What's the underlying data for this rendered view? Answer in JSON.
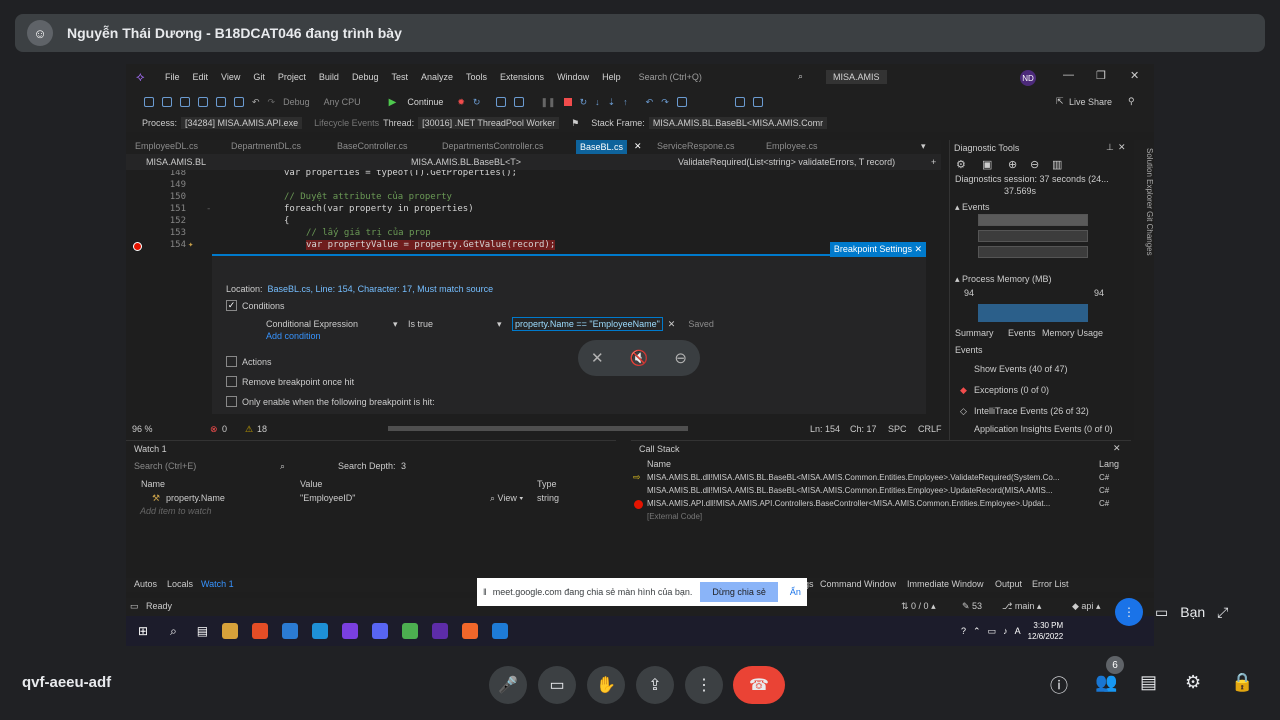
{
  "meet": {
    "presenter_banner": "Nguyễn Thái Dương - B18DCAT046 đang trình bày",
    "avatar_glyph": "☺",
    "meeting_code": "qvf-aeeu-adf",
    "you_label": "Bạn",
    "participant_count": "6",
    "share_notice": "meet.google.com đang chia sẻ màn hình của bạn.",
    "stop_share_label": "Dừng chia sẻ",
    "hide_label": "Ẩn"
  },
  "vs": {
    "menu": [
      "File",
      "Edit",
      "View",
      "Git",
      "Project",
      "Build",
      "Debug",
      "Test",
      "Analyze",
      "Tools",
      "Extensions",
      "Window",
      "Help"
    ],
    "search_placeholder": "Search (Ctrl+Q)",
    "solution_name": "MISA.AMIS",
    "user_initials": "ND",
    "toolbar": {
      "config": "Debug",
      "platform": "Any CPU",
      "continue_label": "Continue",
      "live_share": "Live Share"
    },
    "debug_bar": {
      "process_label": "Process:",
      "process_value": "[34284] MISA.AMIS.API.exe",
      "lifecycle_label": "Lifecycle Events",
      "thread_label": "Thread:",
      "thread_value": "[30016] .NET ThreadPool Worker",
      "stack_label": "Stack Frame:",
      "stack_value": "MISA.AMIS.BL.BaseBL<MISA.AMIS.Comr"
    },
    "tabs": [
      "EmployeeDL.cs",
      "DepartmentDL.cs",
      "BaseController.cs",
      "DepartmentsController.cs",
      "BaseBL.cs",
      "ServiceRespone.cs",
      "Employee.cs"
    ],
    "nav": {
      "project": "MISA.AMIS.BL",
      "class": "MISA.AMIS.BL.BaseBL<T>",
      "method": "ValidateRequired(List<string> validateErrors, T record)"
    },
    "code": {
      "line_148": "148",
      "line_149": "149",
      "line_150": "150",
      "line_151": "151",
      "line_152": "152",
      "line_153": "153",
      "line_154": "154",
      "text_148": "var properties = typeof(T).GetProperties();",
      "text_150": "// Duyệt attribute của property",
      "text_151": "foreach(var property in properties)",
      "text_152": "{",
      "text_153": "// lấy giá trị của prop",
      "text_154": "var propertyValue = property.GetValue(record);"
    },
    "breakpoint": {
      "title": "Breakpoint Settings",
      "location_label": "Location:",
      "location_value": "BaseBL.cs, Line: 154, Character: 17, Must match source",
      "conditions_label": "Conditions",
      "cond_type": "Conditional Expression",
      "cond_op": "Is true",
      "cond_expr": "property.Name == \"EmployeeName\"",
      "saved_label": "Saved",
      "add_condition": "Add condition",
      "actions_label": "Actions",
      "remove_once": "Remove breakpoint once hit",
      "only_enable": "Only enable when the following breakpoint is hit:"
    },
    "diagnostics": {
      "title": "Diagnostic Tools",
      "session": "Diagnostics session: 37 seconds (24...",
      "time_mark": "37.569s",
      "events_label": "Events",
      "memory_label": "Process Memory (MB)",
      "memory_value_left": "94",
      "memory_value_right": "94",
      "tabs": [
        "Summary",
        "Events",
        "Memory Usage"
      ],
      "events_header": "Events",
      "show_events": "Show Events (40 of 47)",
      "exceptions": "Exceptions (0 of 0)",
      "intellitrace": "IntelliTrace Events (26 of 32)",
      "app_insights": "Application Insights Events (0 of 0)"
    },
    "side_tabs": "Solution Explorer   Git Changes",
    "status_line": {
      "zoom": "96 %",
      "errors": "0",
      "warnings": "18",
      "ln": "Ln: 154",
      "ch": "Ch: 17",
      "spc": "SPC",
      "crlf": "CRLF"
    },
    "watch": {
      "title": "Watch 1",
      "search": "Search (Ctrl+E)",
      "depth_label": "Search Depth:",
      "depth_value": "3",
      "col_name": "Name",
      "col_value": "Value",
      "col_type": "Type",
      "row_name": "property.Name",
      "row_value": "\"EmployeeID\"",
      "row_view": "View",
      "row_type": "string",
      "add_item": "Add item to watch"
    },
    "callstack": {
      "title": "Call Stack",
      "col_name": "Name",
      "col_lang": "Lang",
      "rows": [
        {
          "name": "MISA.AMIS.BL.dll!MISA.AMIS.BL.BaseBL<MISA.AMIS.Common.Entities.Employee>.ValidateRequired(System.Co...",
          "lang": "C#"
        },
        {
          "name": "MISA.AMIS.BL.dll!MISA.AMIS.BL.BaseBL<MISA.AMIS.Common.Entities.Employee>.UpdateRecord(MISA.AMIS...",
          "lang": "C#"
        },
        {
          "name": "MISA.AMIS.API.dll!MISA.AMIS.API.Controllers.BaseController<MISA.AMIS.Common.Entities.Employee>.Updat...",
          "lang": "C#"
        },
        {
          "name": "[External Code]",
          "lang": ""
        }
      ]
    },
    "bottom_tabs": [
      "Autos",
      "Locals",
      "Watch 1"
    ],
    "bottom_tabs_right": [
      "gs",
      "Command Window",
      "Immediate Window",
      "Output",
      "Error List"
    ],
    "status": {
      "ready": "Ready",
      "sync": "0 / 0",
      "edits": "53",
      "branch": "main",
      "repo": "api"
    }
  },
  "taskbar": {
    "time": "3:30 PM",
    "date": "12/6/2022",
    "colors": [
      "#4a90e2",
      "#d8a23a",
      "#e44d26",
      "#2b7bd3",
      "#1e90d6",
      "#7a3fe0",
      "#5865f2",
      "#4caf50",
      "#5d2ca8",
      "#f2672a",
      "#1e7bd6"
    ]
  }
}
